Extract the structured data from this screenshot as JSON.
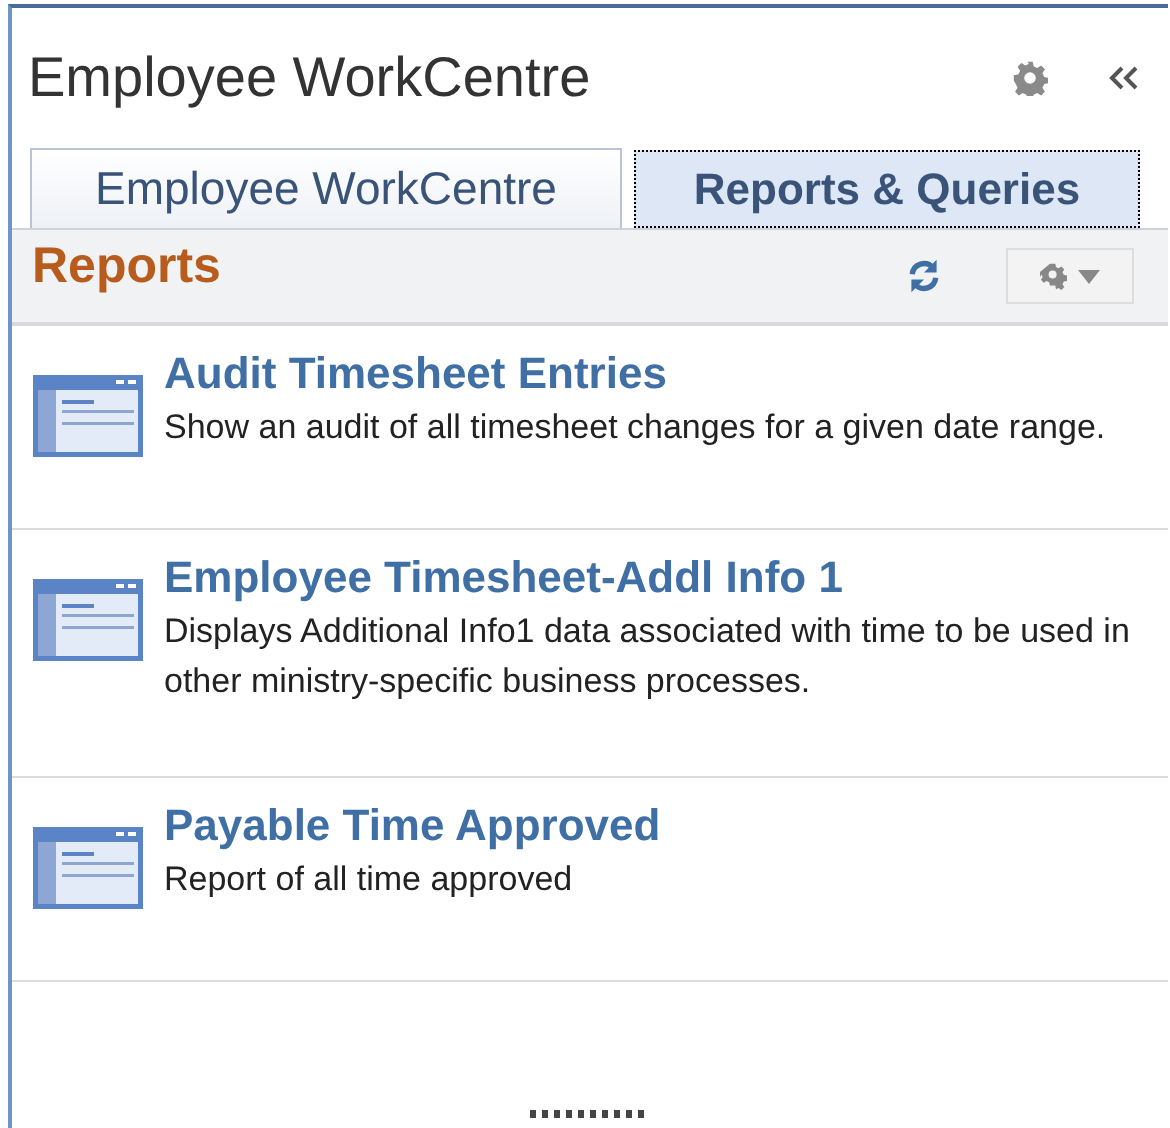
{
  "title": "Employee WorkCentre",
  "tabs": [
    {
      "label": "Employee WorkCentre",
      "selected": false
    },
    {
      "label": "Reports & Queries",
      "selected": true
    }
  ],
  "section": {
    "title": "Reports"
  },
  "reports": [
    {
      "title": "Audit Timesheet Entries",
      "description": "Show an audit of all timesheet changes for a given date range."
    },
    {
      "title": "Employee Timesheet-Addl Info 1",
      "description": "Displays Additional Info1 data associated with time to be used in other ministry-specific business processes."
    },
    {
      "title": "Payable Time Approved",
      "description": "Report of all time approved"
    }
  ]
}
